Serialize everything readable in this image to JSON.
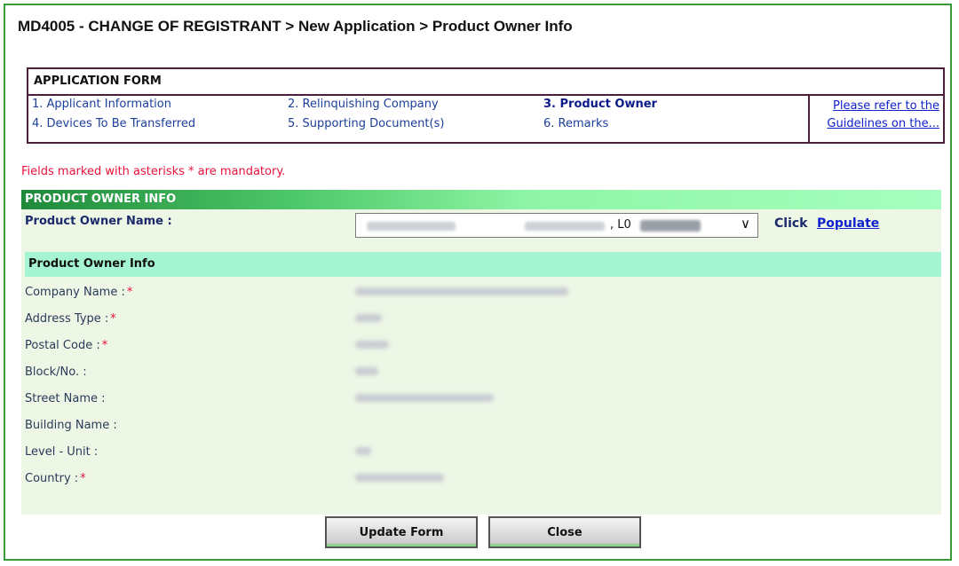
{
  "page_title": "MD4005 - CHANGE OF REGISTRANT > New Application > Product Owner Info",
  "application_form": {
    "header": "APPLICATION FORM",
    "steps": [
      {
        "label": "1. Applicant Information",
        "active": false
      },
      {
        "label": "2. Relinquishing Company",
        "active": false
      },
      {
        "label": "3. Product Owner",
        "active": true
      },
      {
        "label": "4. Devices To Be Transferred",
        "active": false
      },
      {
        "label": "5. Supporting Document(s)",
        "active": false
      },
      {
        "label": "6. Remarks",
        "active": false
      }
    ],
    "guidelines_line1": "Please refer to the",
    "guidelines_line2": "Guidelines on the..."
  },
  "mandatory_note": "Fields marked with asterisks * are mandatory.",
  "product_owner_section": {
    "header": "PRODUCT OWNER INFO",
    "name_label": "Product Owner Name :",
    "selected_value": ", L0",
    "click_label": "Click",
    "populate_label": "Populate"
  },
  "owner_info": {
    "header": "Product Owner Info",
    "fields": [
      {
        "label": "Company Name :",
        "required": "*"
      },
      {
        "label": "Address Type :",
        "required": "*"
      },
      {
        "label": "Postal Code :",
        "required": "*"
      },
      {
        "label": "Block/No. :",
        "required": ""
      },
      {
        "label": "Street Name :",
        "required": ""
      },
      {
        "label": "Building Name :",
        "required": ""
      },
      {
        "label": "Level - Unit :",
        "required": ""
      },
      {
        "label": "Country :",
        "required": "*"
      }
    ]
  },
  "buttons": {
    "update": "Update Form",
    "close": "Close"
  }
}
